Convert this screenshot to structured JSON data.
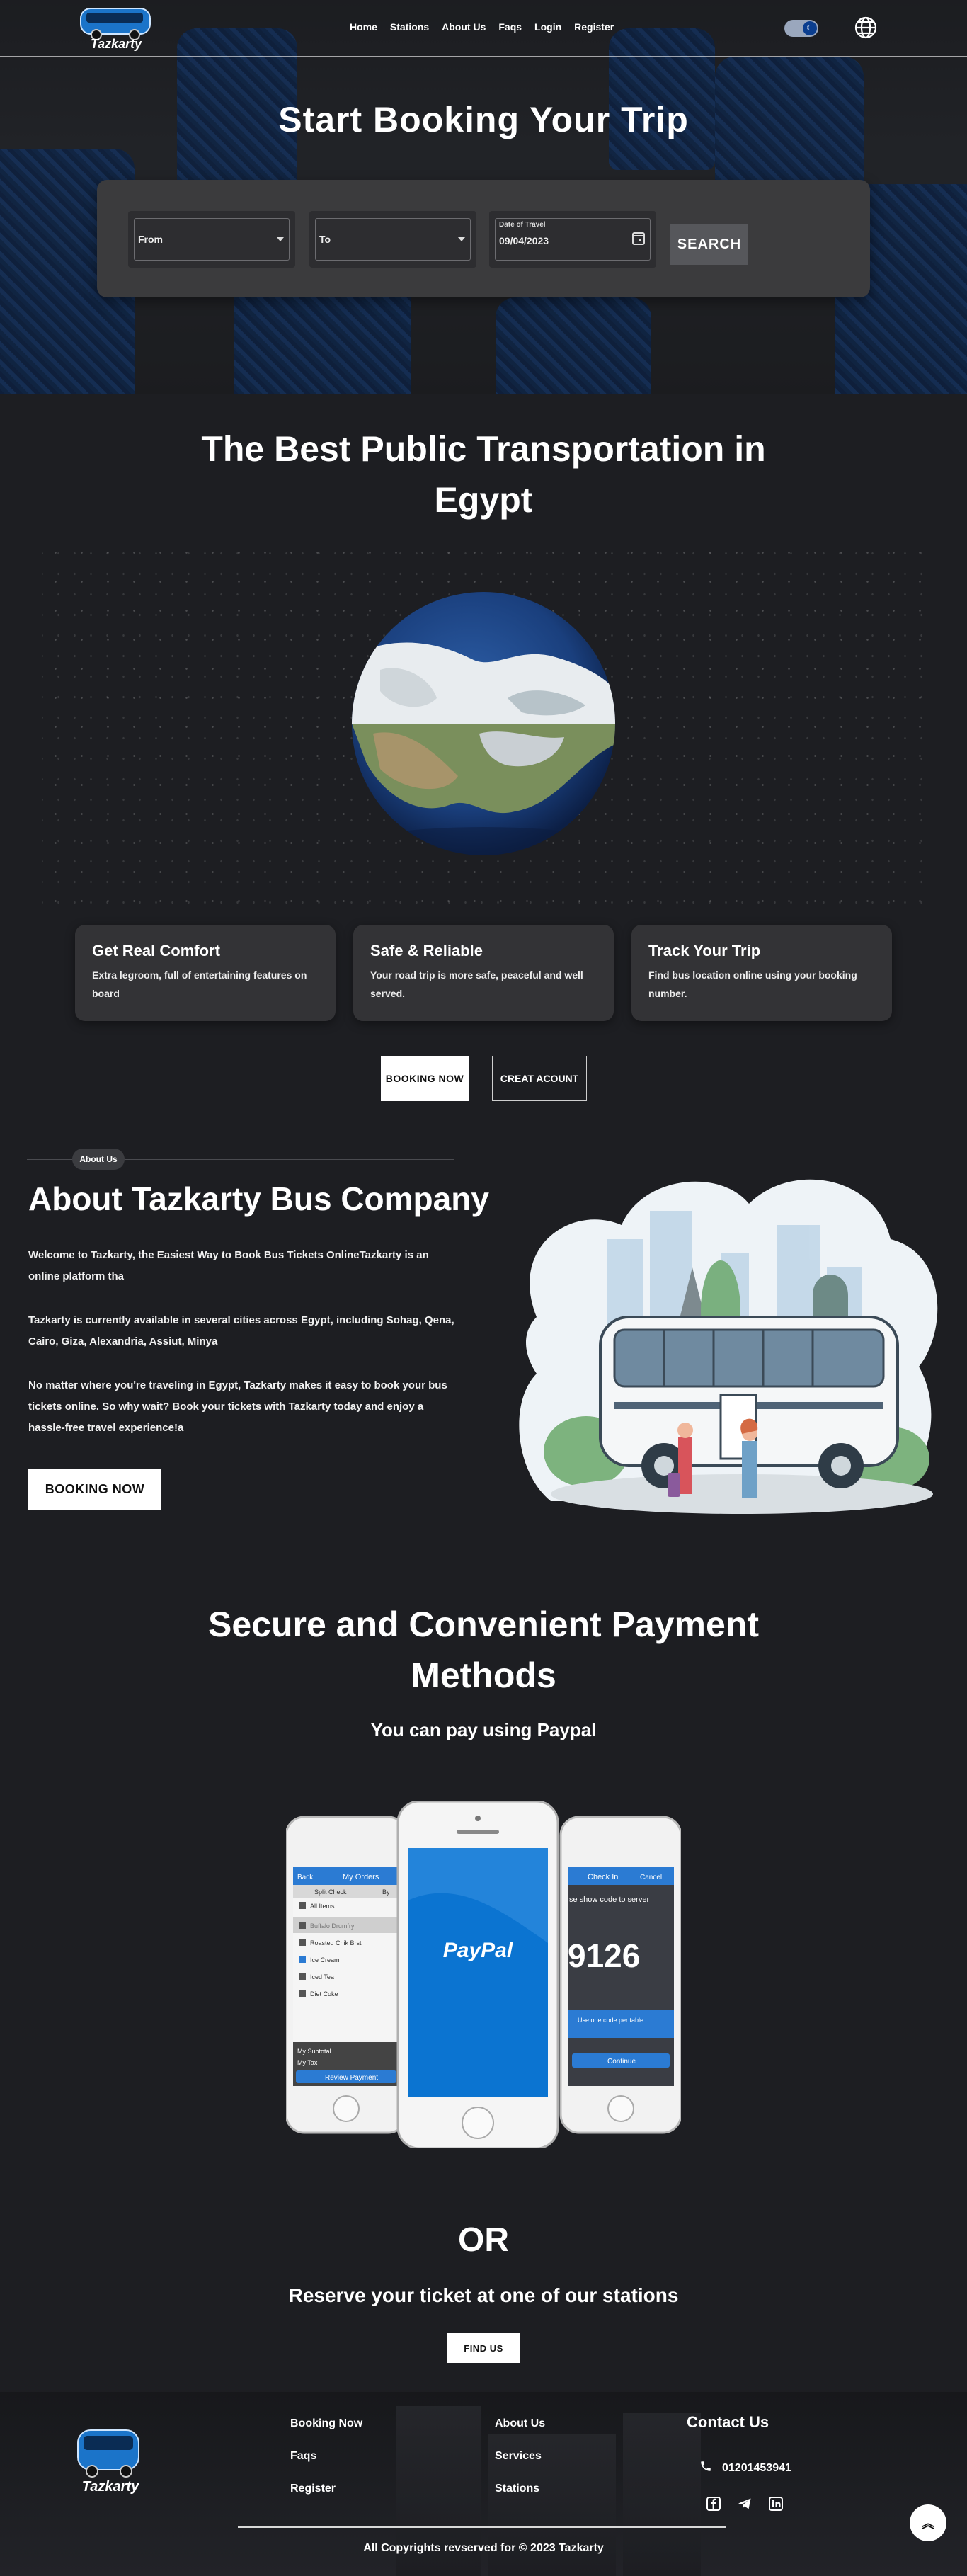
{
  "nav": {
    "logo_text": "Tazkarty",
    "links": [
      "Home",
      "Stations",
      "About Us",
      "Faqs",
      "Login",
      "Register"
    ]
  },
  "hero": {
    "title": "Start Booking Your Trip",
    "from_value": "From",
    "to_value": "To",
    "date_label": "Date of Travel",
    "date_value": "09/04/2023",
    "search_label": "SEARCH"
  },
  "transport": {
    "title_line1": "The Best Public Transportation in",
    "title_line2": "Egypt",
    "features": [
      {
        "title": "Get Real Comfort",
        "text": "Extra legroom, full of entertaining features on board"
      },
      {
        "title": "Safe & Reliable",
        "text": "Your road trip is more safe, peaceful and well served."
      },
      {
        "title": "Track Your Trip",
        "text": "Find bus location online using your booking number."
      }
    ],
    "booking_now": "BOOKING NOW",
    "creat_account": "CREAT ACOUNT"
  },
  "about": {
    "badge": "About Us",
    "title": "About Tazkarty Bus Company",
    "p1": "Welcome to Tazkarty, the Easiest Way to Book Bus Tickets OnlineTazkarty is an online platform tha",
    "p2": "Tazkarty is currently available in several cities across Egypt, including Sohag, Qena, Cairo, Giza, Alexandria, Assiut, Minya",
    "p3": "No matter where you're traveling in Egypt, Tazkarty makes it easy to book your bus tickets online. So why wait? Book your tickets with Tazkarty today and enjoy a hassle-free travel experience!a",
    "button": "BOOKING NOW"
  },
  "payment": {
    "title_line1": "Secure and Convenient Payment",
    "title_line2": "Methods",
    "subtitle": "You can pay using Paypal",
    "phone_left": {
      "back": "Back",
      "header": "My Orders",
      "split": "Split Check",
      "by": "By",
      "items": [
        "All Items",
        "Buffalo Drumfry",
        "Roasted Chik Brst",
        "Ice Cream",
        "Iced Tea",
        "Diet Coke"
      ],
      "subtotal": "My Subtotal",
      "tax": "My Tax",
      "review": "Review Payment"
    },
    "phone_center": {
      "brand": "PayPal"
    },
    "phone_right": {
      "header": "Check In",
      "cancel": "Cancel",
      "instruction": "se show code to server",
      "code": "9126",
      "note": "Use one code per table.",
      "button": "Continue"
    }
  },
  "stations": {
    "or": "OR",
    "text": "Reserve your ticket at one of our stations",
    "button": "FIND US"
  },
  "footer": {
    "logo_text": "Tazkarty",
    "col1": [
      "Booking Now",
      "Faqs",
      "Register"
    ],
    "col2": [
      "About Us",
      "Services",
      "Stations"
    ],
    "contact_title": "Contact Us",
    "phone": "01201453941",
    "copyright": "All Copyrights revserved for © 2023 Tazkarty"
  },
  "colors": {
    "background": "#1d1e22",
    "card": "#333336",
    "paypal_blue": "#0b74d1",
    "toggle_knob": "#0b3e8f"
  },
  "icons": [
    "bus-logo-icon",
    "theme-toggle-icon",
    "globe-icon",
    "calendar-icon",
    "phone-icon",
    "facebook-icon",
    "telegram-icon",
    "linkedin-icon",
    "chevron-up-icon"
  ]
}
